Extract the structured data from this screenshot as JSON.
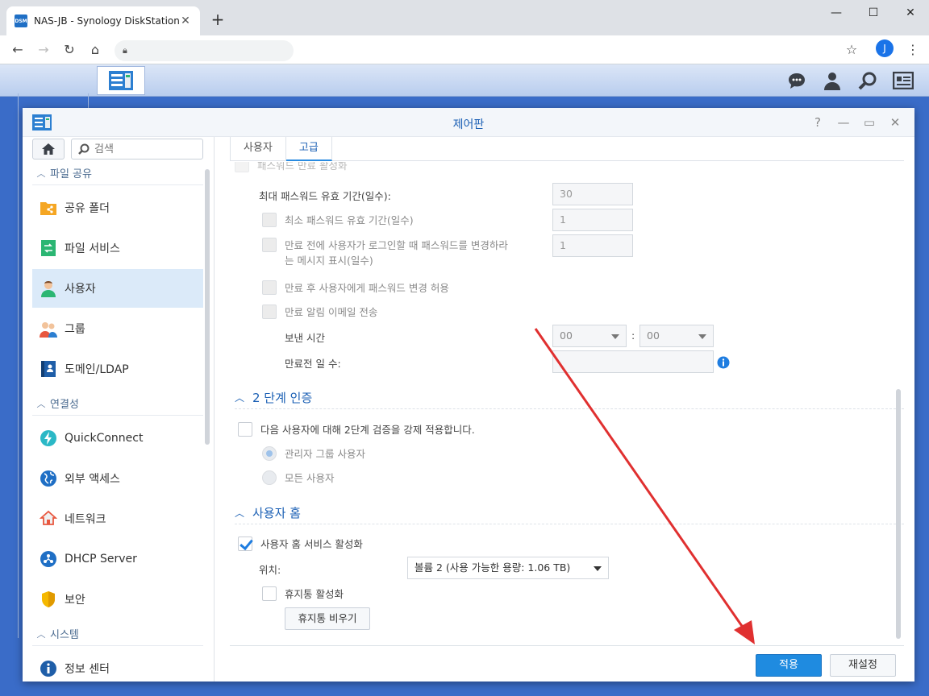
{
  "browser": {
    "tab_title": "NAS-JB - Synology DiskStation",
    "favicon_text": "DSM",
    "avatar_letter": "J",
    "address": ""
  },
  "window": {
    "title": "제어판"
  },
  "sidebar": {
    "search_placeholder": "검색",
    "sections": [
      {
        "label": "파일 공유",
        "items": [
          "공유 폴더",
          "파일 서비스",
          "사용자",
          "그룹",
          "도메인/LDAP"
        ]
      },
      {
        "label": "연결성",
        "items": [
          "QuickConnect",
          "외부 액세스",
          "네트워크",
          "DHCP Server",
          "보안"
        ]
      },
      {
        "label": "시스템",
        "items": [
          "정보 센터"
        ]
      }
    ],
    "active_item": "사용자"
  },
  "tabs": [
    "사용자",
    "고급"
  ],
  "active_tab": "고급",
  "password_expiry": {
    "cut_top_label": "패스워드 만료 활성화",
    "max_days_label": "최대 패스워드 유효 기간(일수):",
    "max_days_value": "30",
    "min_days_label": "최소 패스워드 유효 기간(일수)",
    "min_days_value": "1",
    "prompt_label_line1": "만료 전에 사용자가 로그인할 때 패스워드를 변경하라",
    "prompt_label_line2": "는 메시지 표시(일수)",
    "prompt_value": "1",
    "allow_change_label": "만료 후 사용자에게 패스워드 변경 허용",
    "email_label": "만료 알림 이메일 전송",
    "send_time_label": "보낸 시간",
    "send_hour": "00",
    "time_sep": ":",
    "send_minute": "00",
    "days_before_label": "만료전 일 수:",
    "days_before_value": ""
  },
  "two_step": {
    "title": "2 단계 인증",
    "enforce_label": "다음 사용자에 대해 2단계 검증을 강제 적용합니다.",
    "option_admin": "관리자 그룹 사용자",
    "option_all": "모든 사용자"
  },
  "user_home": {
    "title": "사용자 홈",
    "enable_label": "사용자 홈 서비스 활성화",
    "location_label": "위치:",
    "location_value": "볼륨 2 (사용 가능한 용량: 1.06 TB)",
    "recycle_label": "휴지통 활성화",
    "empty_recycle_button": "휴지통 비우기"
  },
  "footer": {
    "apply": "적용",
    "reset": "재설정"
  },
  "colors": {
    "accent": "#1f8be0",
    "heading": "#1a5fb4",
    "annotation_arrow": "#e03030"
  }
}
